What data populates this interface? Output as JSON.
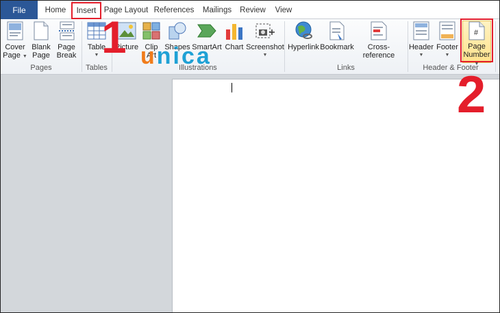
{
  "tabs": {
    "file": "File",
    "home": "Home",
    "insert": "Insert",
    "page_layout": "Page Layout",
    "references": "References",
    "mailings": "Mailings",
    "review": "Review",
    "view": "View"
  },
  "ribbon": {
    "pages": {
      "label": "Pages",
      "cover_page": [
        "Cover",
        "Page"
      ],
      "blank_page": [
        "Blank",
        "Page"
      ],
      "page_break": [
        "Page",
        "Break"
      ]
    },
    "tables": {
      "label": "Tables",
      "table": "Table"
    },
    "illustrations": {
      "label": "Illustrations",
      "picture": "Picture",
      "clip_art": [
        "Clip",
        "Art"
      ],
      "shapes": "Shapes",
      "smartart": "SmartArt",
      "chart": "Chart",
      "screenshot": "Screenshot"
    },
    "links": {
      "label": "Links",
      "hyperlink": "Hyperlink",
      "bookmark": "Bookmark",
      "cross_reference": "Cross-reference"
    },
    "header_footer": {
      "label": "Header & Footer",
      "header": "Header",
      "footer": "Footer",
      "page_number": [
        "Page",
        "Number"
      ]
    }
  },
  "annotations": {
    "step1": "1",
    "step2": "2",
    "logo_u": "u",
    "logo_rest": "nica",
    "color_red": "#e41e2b"
  },
  "colors": {
    "file_tab": "#2b5797",
    "highlight": "#ffe28c",
    "workspace": "#d3d7db"
  }
}
